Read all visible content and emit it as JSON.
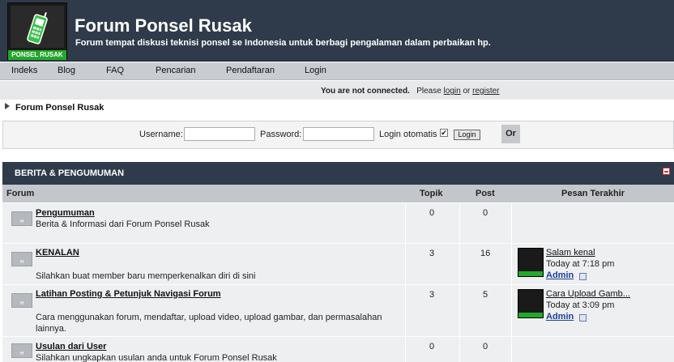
{
  "header": {
    "logo_text": "PONSEL RUSAK",
    "title": "Forum Ponsel Rusak",
    "description": "Forum tempat diskusi teknisi ponsel se Indonesia untuk berbagi pengalaman dalam perbaikan hp."
  },
  "nav": {
    "items": [
      "Indeks",
      "Blog",
      "FAQ",
      "Pencarian",
      "Pendaftaran",
      "Login"
    ]
  },
  "status": {
    "not_connected": "You are not connected.",
    "please": "Please",
    "login": "login",
    "or": "or",
    "register": "register"
  },
  "breadcrumb": "Forum Ponsel Rusak",
  "login_form": {
    "username_label": "Username:",
    "username_value": "",
    "password_label": "Password:",
    "password_value": "",
    "auto_login_label": "Login otomatis",
    "auto_login_checked": true,
    "login_button": "Login",
    "or_button": "Or"
  },
  "category": {
    "title": "BERITA & PENGUMUMAN",
    "columns": [
      "Forum",
      "Topik",
      "Post",
      "Pesan Terakhir"
    ]
  },
  "forums": [
    {
      "name": "Pengumuman",
      "description": "Berita & Informasi dari Forum Ponsel Rusak",
      "topics": "0",
      "posts": "0",
      "last_post": null
    },
    {
      "name": "KENALAN",
      "description": "Silahkan buat member baru memperkenalkan diri di sini",
      "topics": "3",
      "posts": "16",
      "last_post": {
        "title": "Salam kenal",
        "time": "Today at 7:18 pm",
        "user": "Admin"
      }
    },
    {
      "name": "Latihan Posting & Petunjuk Navigasi Forum",
      "description": "Cara menggunakan forum, mendaftar, upload video, upload gambar, dan permasalahan lainnya.",
      "topics": "3",
      "posts": "5",
      "last_post": {
        "title": "Cara Upload Gamb...",
        "time": "Today at 3:09 pm",
        "user": "Admin"
      }
    },
    {
      "name": "Usulan dari User",
      "description": "Silahkan ungkapkan usulan anda untuk Forum Ponsel Rusak",
      "topics": "0",
      "posts": "0",
      "last_post": null
    }
  ],
  "icons": {
    "forum_icon": "quote-bubble-icon",
    "last_post_go": "go-to-post-icon",
    "collapse": "collapse-minus-icon",
    "logo": "cellphone-icon"
  },
  "colors": {
    "header_bg": "#2f3a4a",
    "nav_bg": "#c9ccd0",
    "logo_green": "#22a82a",
    "row_bg": "#eeeff1"
  }
}
